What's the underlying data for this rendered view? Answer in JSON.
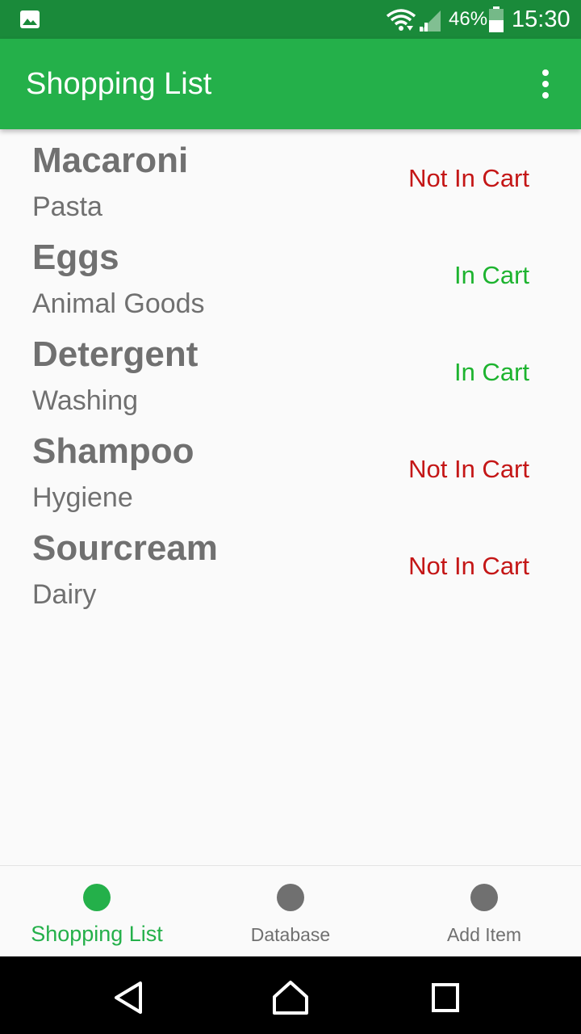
{
  "status_bar": {
    "battery_percent": "46%",
    "time": "15:30",
    "icons": [
      "gallery-icon",
      "wifi-icon",
      "signal-icon",
      "battery-icon"
    ]
  },
  "app_bar": {
    "title": "Shopping List",
    "menu_icon": "more-vert-icon"
  },
  "items": [
    {
      "name": "Macaroni",
      "category": "Pasta",
      "status": "Not In Cart",
      "in_cart": false
    },
    {
      "name": "Eggs",
      "category": "Animal Goods",
      "status": "In Cart",
      "in_cart": true
    },
    {
      "name": "Detergent",
      "category": "Washing",
      "status": "In Cart",
      "in_cart": true
    },
    {
      "name": "Shampoo",
      "category": "Hygiene",
      "status": "Not In Cart",
      "in_cart": false
    },
    {
      "name": "Sourcream",
      "category": "Dairy",
      "status": "Not In Cart",
      "in_cart": false
    }
  ],
  "bottom_nav": {
    "items": [
      {
        "label": "Shopping List",
        "active": true
      },
      {
        "label": "Database",
        "active": false
      },
      {
        "label": "Add Item",
        "active": false
      }
    ]
  },
  "system_nav": [
    "back-icon",
    "home-icon",
    "recents-icon"
  ],
  "colors": {
    "status_bar": "#1a8a3a",
    "primary": "#24b04a",
    "in_cart": "#1db32f",
    "not_in_cart": "#c41616",
    "text_secondary": "#707070",
    "nav_inactive": "#707070"
  }
}
